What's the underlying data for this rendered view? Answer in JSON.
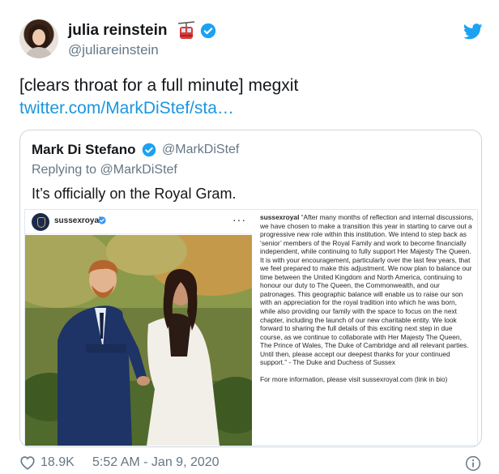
{
  "author": {
    "name": "julia reinstein",
    "handle": "@juliareinstein",
    "emoji_icon": "aerial-tramway-icon",
    "verified_icon": "verified-badge-icon"
  },
  "tweet": {
    "text": "[clears throat for a full minute] megxit",
    "link": "twitter.com/MarkDiStef/sta…"
  },
  "quoted": {
    "name": "Mark Di Stefano",
    "handle": "@MarkDiStef",
    "reply_prefix": "Replying to",
    "reply_handle": "@MarkDiStef",
    "text": "It’s officially on the Royal Gram."
  },
  "instagram": {
    "account": "sussexroyal",
    "more": "···",
    "caption_account": "sussexroyal",
    "caption": "“After many months of reflection and internal discussions, we have chosen to make a transition this year in starting to carve out a progressive new role within this institution. We intend to step back as ‘senior’ members of the Royal Family and work to become financially independent, while continuing to fully support Her Majesty The Queen. It is with your encouragement, particularly over the last few years, that we feel prepared to make this adjustment. We now plan to balance our time between the United Kingdom and North America, continuing to honour our duty to The Queen, the Commonwealth, and our patronages. This geographic balance will enable us to raise our son with an appreciation for the royal tradition into which he was born, while also providing our family with the space to focus on the next chapter, including the launch of our new charitable entity. We look forward to sharing the full details of this exciting next step in due course, as we continue to collaborate with Her Majesty The Queen, The Prince of Wales, The Duke of Cambridge and all relevant parties. Until then, please accept our deepest thanks for your continued support.” - The Duke and Duchess of Sussex",
    "more_info": "For more information, please visit sussexroyal.com (link in bio)"
  },
  "footer": {
    "likes": "18.9K",
    "timestamp": "5:52 AM - Jan 9, 2020"
  },
  "colors": {
    "twitter_blue": "#1da1f2",
    "link_blue": "#1b95e0",
    "secondary_text": "#657786",
    "border": "#ccd6dd"
  }
}
